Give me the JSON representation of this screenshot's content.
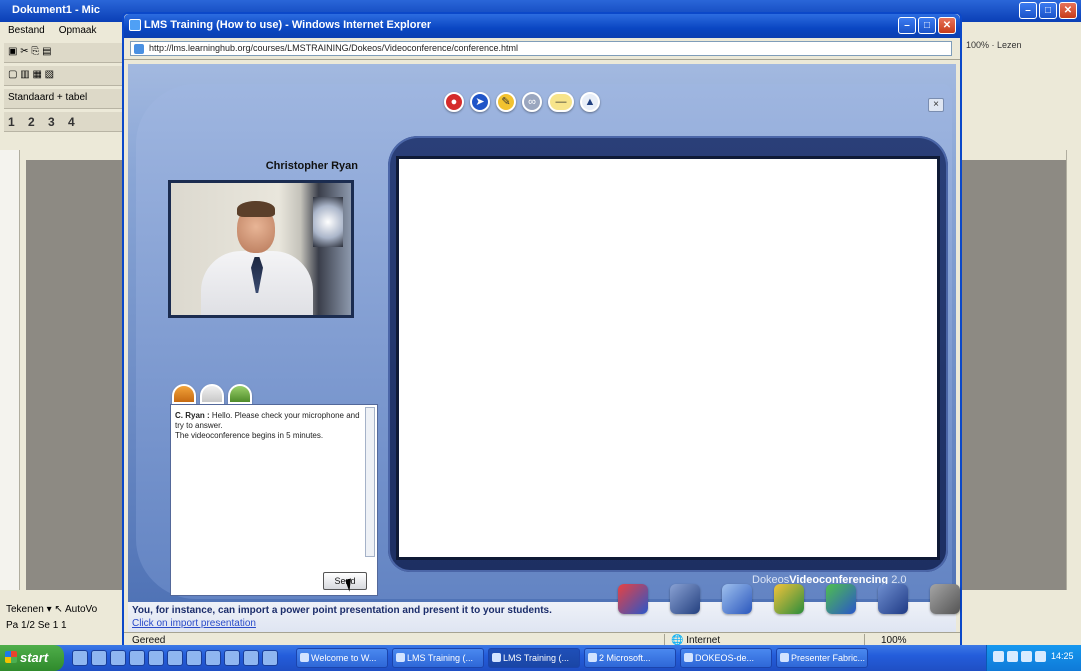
{
  "background_window": {
    "title": "Dokument1 - Mic",
    "menu": [
      "Bestand",
      "Opmaak"
    ],
    "toolbar_text": "Standaard + tabel",
    "numbers": "1 2 3 4",
    "right_toolbar": "100% · Lezen",
    "status_line1": "Tekenen ▾ ↖ AutoVo",
    "status_line2": "Pa 1/2   Se 1   1"
  },
  "ie_window": {
    "title": "LMS Training (How to use) - Windows Internet Explorer",
    "address": "http://lms.learninghub.org/courses/LMSTRAINING/Dokeos/Videoconference/conference.html",
    "status": "Gereed",
    "zone": "Internet",
    "zoom": "100%"
  },
  "app": {
    "presenter_name": "Christopher Ryan",
    "tools": [
      "record",
      "pointer",
      "pen",
      "link",
      "minus",
      "eject"
    ],
    "close_symbol": "×",
    "chat": {
      "author": "C. Ryan :",
      "message": "Hello. Please check your microphone and try to answer.",
      "message2": "The videoconference begins in 5 minutes.",
      "send_label": "Send"
    },
    "brand_prefix": "Dokeos",
    "brand_name": "Videoconferencing",
    "brand_version": "2.0"
  },
  "footer": {
    "message": "You, for instance, can import a power point presentation and present it to your students.",
    "link": "Click on import presentation"
  },
  "taskbar": {
    "start_label": "start",
    "tasks": [
      "Welcome to W...",
      "LMS Training (...",
      "LMS Training (...",
      "2 Microsoft...",
      "DOKEOS-de...",
      "Presenter Fabric..."
    ],
    "time": "14:25"
  }
}
